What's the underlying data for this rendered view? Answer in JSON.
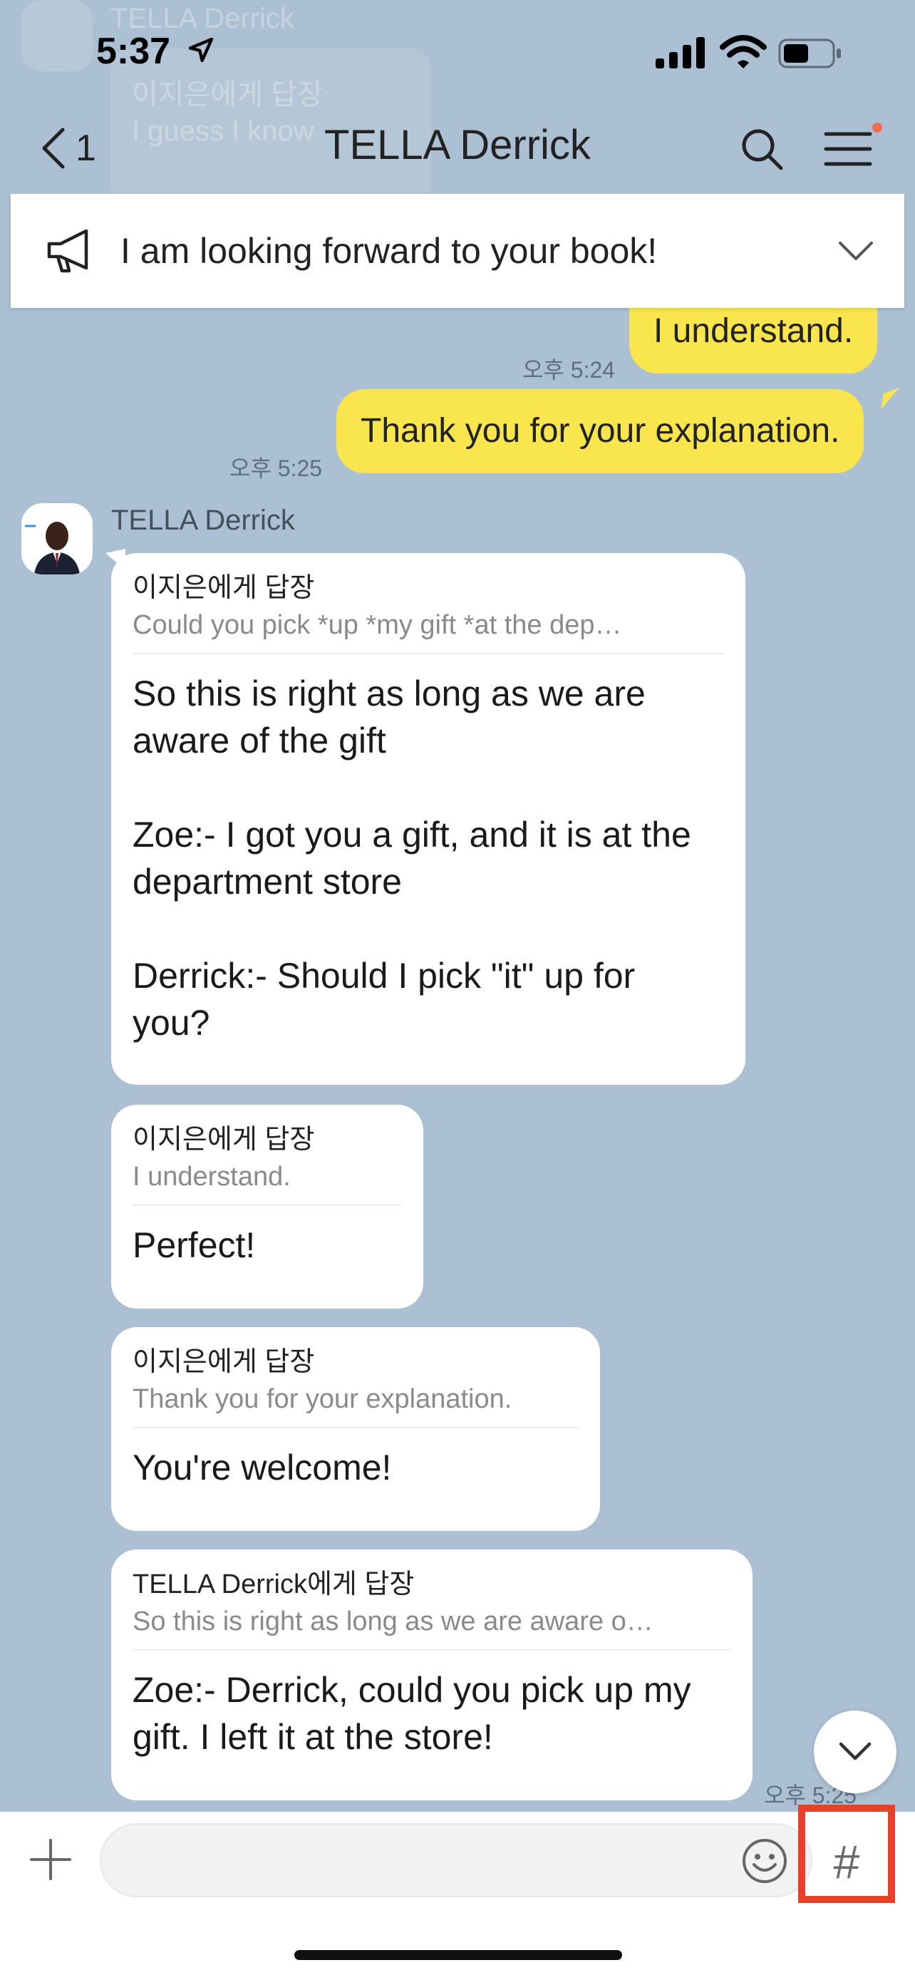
{
  "status_bar": {
    "time": "5:37"
  },
  "ghost_notification": {
    "sender": "TELLA Derrick",
    "line1": "이지은에게 답장",
    "line2": "I guess I know"
  },
  "header": {
    "back_count": "1",
    "title": "TELLA Derrick"
  },
  "notice": {
    "text": "I am looking forward to your book!"
  },
  "my_messages": [
    {
      "text": "I understand.",
      "time": "오후 5:24"
    },
    {
      "text": "Thank you for your explanation.",
      "time": "오후 5:25"
    }
  ],
  "sender": {
    "name": "TELLA Derrick"
  },
  "their_messages": [
    {
      "reply_to": "이지은에게 답장",
      "quote": "Could you pick *up *my gift *at the dep…",
      "text": "So this is right as long as we are\naware of the gift\n\nZoe:- I got you a gift, and it is at the\ndepartment store\n\nDerrick:- Should I pick \"it\" up for\nyou?"
    },
    {
      "reply_to": "이지은에게 답장",
      "quote": "I understand.",
      "text": "Perfect!"
    },
    {
      "reply_to": "이지은에게 답장",
      "quote": "Thank you for your explanation.",
      "text": "You're welcome!"
    },
    {
      "reply_to": "TELLA Derrick에게 답장",
      "quote": "So this is right as long as we are aware o…",
      "text": "Zoe:- Derrick, could you pick up my\ngift. I left it at the store!",
      "time": "오후 5:25"
    }
  ],
  "input": {
    "placeholder": "",
    "hash_label": "#"
  },
  "colors": {
    "background": "#abc0d3",
    "my_bubble": "#f9e54d",
    "highlight_box": "#e8402a",
    "menu_badge": "#f26b4f"
  }
}
